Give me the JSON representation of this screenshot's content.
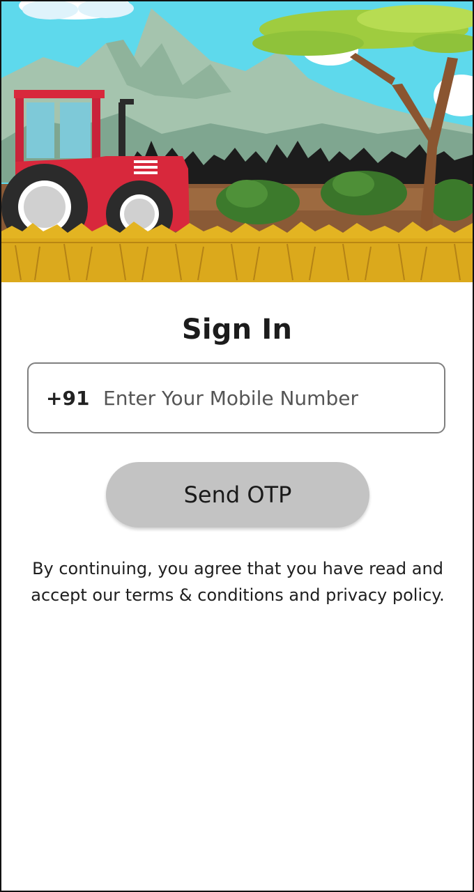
{
  "hero": {
    "image_icon": "farm-tractor-illustration"
  },
  "signin": {
    "title": "Sign In",
    "country_code": "+91",
    "phone_placeholder": "Enter Your Mobile Number",
    "phone_value": "",
    "send_otp_label": "Send OTP",
    "terms_text": "By continuing, you agree that you have read and accept our terms & conditions and privacy policy."
  },
  "colors": {
    "button_bg": "#c3c3c3",
    "field_border": "#7f7f7f",
    "tractor_red": "#d8283c",
    "wheat": "#e3b422"
  }
}
